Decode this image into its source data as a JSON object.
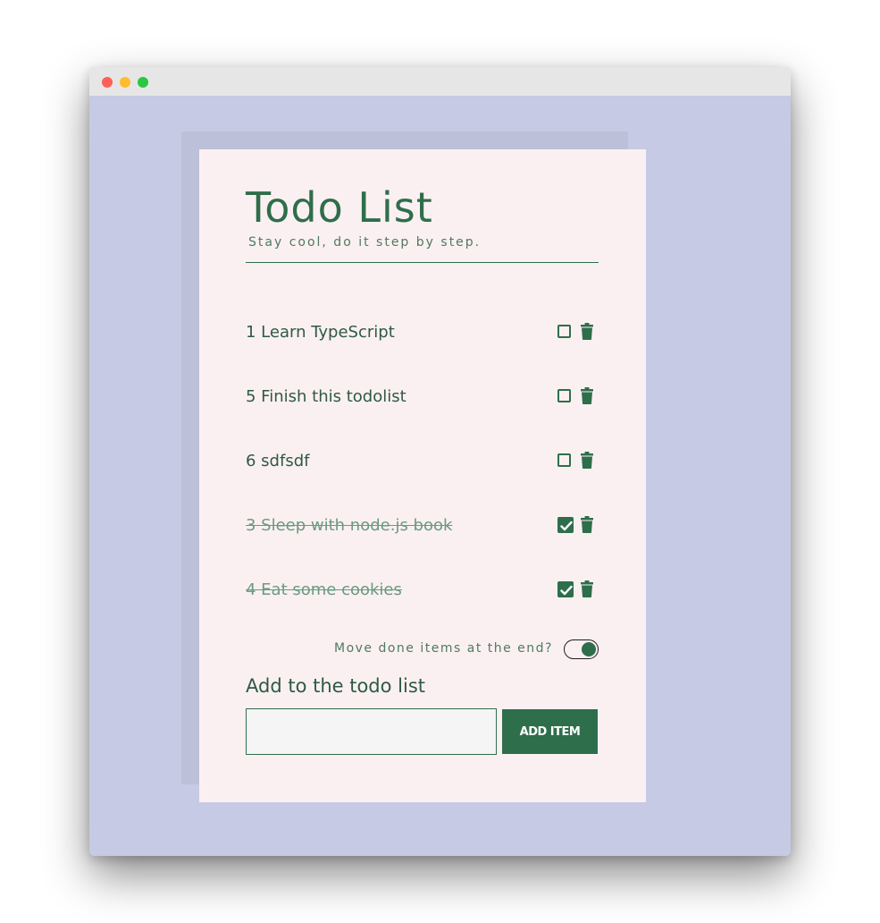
{
  "app": {
    "title": "Todo List",
    "subtitle": "Stay cool, do it step by step."
  },
  "todos": [
    {
      "text": "1 Learn TypeScript",
      "done": false
    },
    {
      "text": "5 Finish this todolist",
      "done": false
    },
    {
      "text": "6 sdfsdf",
      "done": false
    },
    {
      "text": "3 Sleep with node.js book",
      "done": true
    },
    {
      "text": "4 Eat some cookies",
      "done": true
    }
  ],
  "toggle": {
    "label": "Move done items at the end?",
    "on": true
  },
  "add_form": {
    "title": "Add to the todo list",
    "input_value": "",
    "input_placeholder": "",
    "button_label": "ADD ITEM"
  },
  "colors": {
    "accent": "#2e6e4b",
    "background": "#c7cae5",
    "card": "#fbf0f1"
  },
  "icons": {
    "checkbox_unchecked": "checkbox-empty-icon",
    "checkbox_checked": "checkbox-checked-icon",
    "delete": "trash-icon"
  }
}
